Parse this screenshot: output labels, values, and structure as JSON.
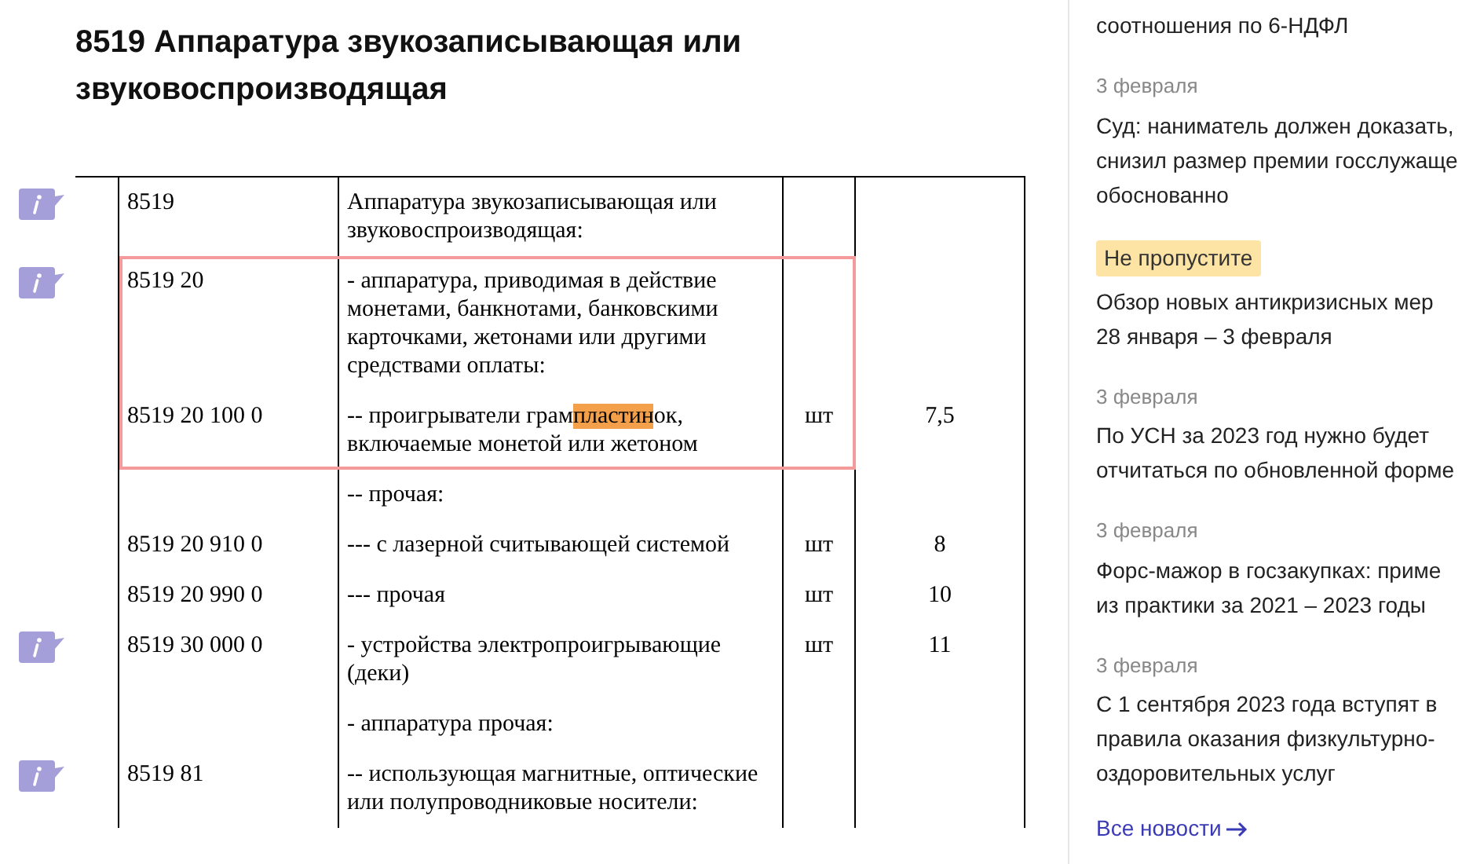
{
  "heading": {
    "lines": [
      "8519 Аппаратура звукозаписывающая или",
      "звуковоспроизводящая"
    ]
  },
  "table": {
    "groups": [
      {
        "highlighted": false,
        "rows": [
          {
            "note": true,
            "code": "8519",
            "description": {
              "text": "Аппаратура звукозаписывающая или звуковоспроизводящая:"
            },
            "unit": "",
            "rate": ""
          }
        ]
      },
      {
        "highlighted": true,
        "rows": [
          {
            "note": true,
            "code": "8519 20",
            "description": {
              "text": "- аппаратура, приводимая в действие монетами, банкнотами, банковскими карточками, жетонами или другими средствами оплаты:"
            },
            "unit": "",
            "rate": ""
          },
          {
            "note": false,
            "code": "8519 20 100 0",
            "description": {
              "text": "-- проигрыватели грам",
              "highlight": "пластин",
              "text_after": "ок, включаемые монетой или жетоном"
            },
            "unit": "шт",
            "rate": "7,5"
          }
        ]
      },
      {
        "highlighted": false,
        "rows": [
          {
            "note": false,
            "code": "",
            "description": {
              "text": "-- прочая:"
            },
            "unit": "",
            "rate": ""
          },
          {
            "note": false,
            "code": "8519 20 910 0",
            "description": {
              "text": "--- с лазерной считывающей системой"
            },
            "unit": "шт",
            "rate": "8"
          },
          {
            "note": false,
            "code": "8519 20 990 0",
            "description": {
              "text": "--- прочая"
            },
            "unit": "шт",
            "rate": "10"
          },
          {
            "note": true,
            "code": "8519 30 000 0",
            "description": {
              "text": "- устройства электропроигрывающие (деки)"
            },
            "unit": "шт",
            "rate": "11"
          },
          {
            "note": false,
            "code": "",
            "description": {
              "text": "- аппаратура прочая:"
            },
            "unit": "",
            "rate": ""
          },
          {
            "note": true,
            "code": "8519 81",
            "description": {
              "text": "-- использующая магнитные, оптические или полупроводниковые носители:"
            },
            "unit": "",
            "rate": ""
          }
        ]
      }
    ]
  },
  "news": {
    "items": [
      {
        "kind": "plain",
        "title_lines": [
          "соотношения по 6-НДФЛ"
        ]
      },
      {
        "kind": "dated",
        "date": "3 февраля",
        "title_lines": [
          "Суд: наниматель должен доказать,",
          "снизил размер премии госслужаще",
          "обоснованно"
        ]
      },
      {
        "kind": "badge",
        "badge": "Не пропустите",
        "title_lines": [
          "Обзор новых антикризисных мер",
          "28 января – 3 февраля"
        ]
      },
      {
        "kind": "dated",
        "date": "3 февраля",
        "title_lines": [
          "По УСН за 2023 год нужно будет",
          "отчитаться по обновленной форме"
        ]
      },
      {
        "kind": "dated",
        "date": "3 февраля",
        "title_lines": [
          "Форс-мажор в госзакупках: приме",
          "из практики за 2021 – 2023 годы"
        ]
      },
      {
        "kind": "dated",
        "date": "3 февраля",
        "title_lines": [
          "С 1 сентября 2023 года вступят в",
          "правила оказания физкультурно-",
          "оздоровительных услуг"
        ]
      }
    ],
    "all_link": "Все новости"
  }
}
